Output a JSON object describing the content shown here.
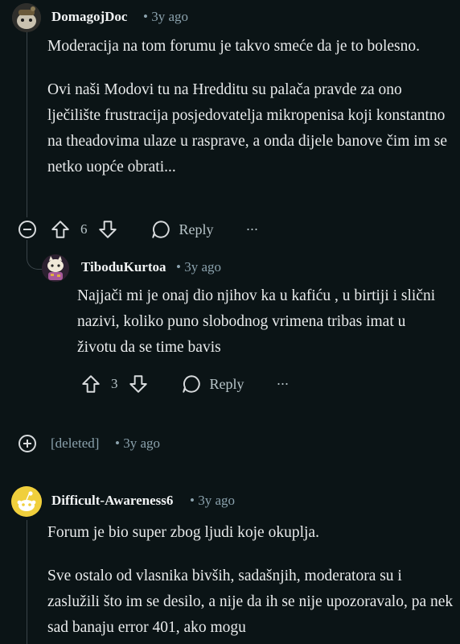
{
  "comments": [
    {
      "username": "DomagojDoc",
      "time": "3y ago",
      "paragraphs": [
        "Moderacija na tom forumu je takvo smeće da je to bolesno.",
        "Ovi naši Modovi tu na Hredditu su palača pravde za ono lječilište frustracija posjedovatelja mikropenisa koji konstantno na theadovima ulaze u rasprave, a onda dijele banove čim im se netko uopće obrati..."
      ],
      "votes": "6",
      "reply_label": "Reply",
      "more_label": "···"
    },
    {
      "username": "TiboduKurtoa",
      "time": "3y ago",
      "paragraphs": [
        "Najjači mi je onaj dio njihov ka u kafiću , u birtiji i slični nazivi, koliko puno slobodnog vrimena tribas imat u životu da se time bavis"
      ],
      "votes": "3",
      "reply_label": "Reply",
      "more_label": "···"
    },
    {
      "username": "[deleted]",
      "time": "3y ago"
    },
    {
      "username": "Difficult-Awareness6",
      "time": "3y ago",
      "paragraphs": [
        "Forum je bio super zbog ljudi koje okuplja.",
        "Sve ostalo od vlasnika bivših, sadašnjih, moderatora su i zaslužili što im se desilo, a nije da ih se nije upozoravalo, pa nek sad banaju error 401, ako mogu"
      ]
    }
  ],
  "meta_separator": "•",
  "icons": {
    "upvote": "arrow-up-icon",
    "downvote": "arrow-down-icon",
    "reply": "speech-bubble-icon",
    "collapse": "minus-circle-icon",
    "expand": "plus-circle-icon"
  },
  "colors": {
    "background": "#0b1416",
    "text": "#e8eaeb",
    "meta": "#8ba2ad",
    "thread_line": "#3a4449"
  }
}
